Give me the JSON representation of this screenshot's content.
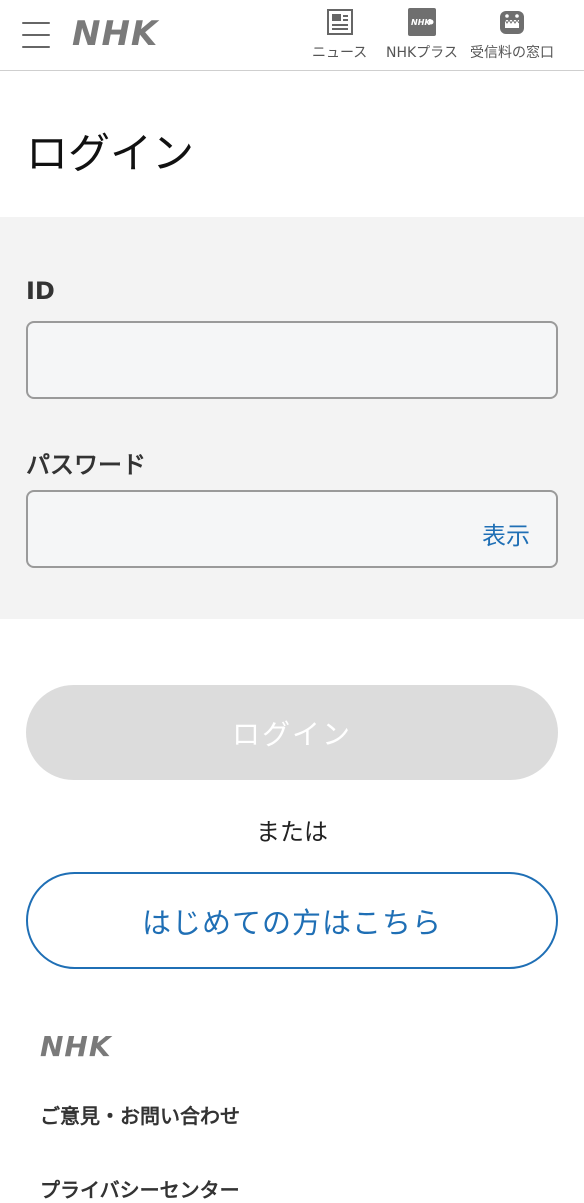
{
  "header": {
    "logo": "NHK",
    "nav": [
      {
        "label": "ニュース",
        "icon": "newspaper-icon"
      },
      {
        "label": "NHKプラス",
        "icon": "nhk-plus-icon"
      },
      {
        "label": "受信料の窓口",
        "icon": "domo-kun-icon"
      }
    ]
  },
  "page": {
    "title": "ログイン"
  },
  "form": {
    "id_label": "ID",
    "id_value": "",
    "password_label": "パスワード",
    "password_value": "",
    "show_toggle": "表示"
  },
  "actions": {
    "login_label": "ログイン",
    "or_text": "または",
    "first_time_label": "はじめての方はこちら"
  },
  "footer": {
    "logo": "NHK",
    "links": [
      "ご意見・お問い合わせ",
      "プライバシーセンター"
    ]
  },
  "colors": {
    "accent": "#1f6fb5",
    "form_background": "#f3f3f3",
    "disabled_button": "#dcdcdc"
  }
}
